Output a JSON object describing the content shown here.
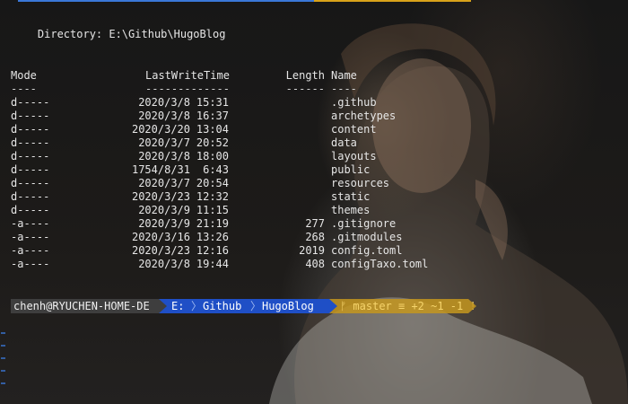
{
  "terminal": {
    "directory_label": "    Directory: E:\\Github\\HugoBlog",
    "headers": {
      "mode": "Mode",
      "last_write_time": "LastWriteTime",
      "length": "Length",
      "name": "Name"
    },
    "separators": {
      "mode": "----",
      "last_write_time": "-------------",
      "length": "------",
      "name": "----"
    },
    "rows": [
      {
        "mode": "d-----",
        "date": "2020/3/8",
        "time": "15:31",
        "length": "",
        "name": ".github"
      },
      {
        "mode": "d-----",
        "date": "2020/3/8",
        "time": "16:37",
        "length": "",
        "name": "archetypes"
      },
      {
        "mode": "d-----",
        "date": "2020/3/20",
        "time": "13:04",
        "length": "",
        "name": "content"
      },
      {
        "mode": "d-----",
        "date": "2020/3/7",
        "time": "20:52",
        "length": "",
        "name": "data"
      },
      {
        "mode": "d-----",
        "date": "2020/3/8",
        "time": "18:00",
        "length": "",
        "name": "layouts"
      },
      {
        "mode": "d-----",
        "date": "1754/8/31",
        "time": "6:43",
        "length": "",
        "name": "public"
      },
      {
        "mode": "d-----",
        "date": "2020/3/7",
        "time": "20:54",
        "length": "",
        "name": "resources"
      },
      {
        "mode": "d-----",
        "date": "2020/3/23",
        "time": "12:32",
        "length": "",
        "name": "static"
      },
      {
        "mode": "d-----",
        "date": "2020/3/9",
        "time": "11:15",
        "length": "",
        "name": "themes"
      },
      {
        "mode": "-a----",
        "date": "2020/3/9",
        "time": "21:19",
        "length": "277",
        "name": ".gitignore"
      },
      {
        "mode": "-a----",
        "date": "2020/3/16",
        "time": "13:26",
        "length": "268",
        "name": ".gitmodules"
      },
      {
        "mode": "-a----",
        "date": "2020/3/23",
        "time": "12:16",
        "length": "2019",
        "name": "config.toml"
      },
      {
        "mode": "-a----",
        "date": "2020/3/8",
        "time": "19:44",
        "length": "408",
        "name": "configTaxo.toml"
      }
    ]
  },
  "prompt": {
    "user_host": "chenh@RYUCHEN-HOME-DE",
    "path_parts": [
      "E:",
      "Github",
      "HugoBlog"
    ],
    "git_status": "ᚠ master ≡ +2 ~1 -1 !"
  },
  "colors": {
    "accent_blue": "#1f4fc6",
    "accent_gold": "#c4961e",
    "user_segment": "#3e3e3e"
  }
}
